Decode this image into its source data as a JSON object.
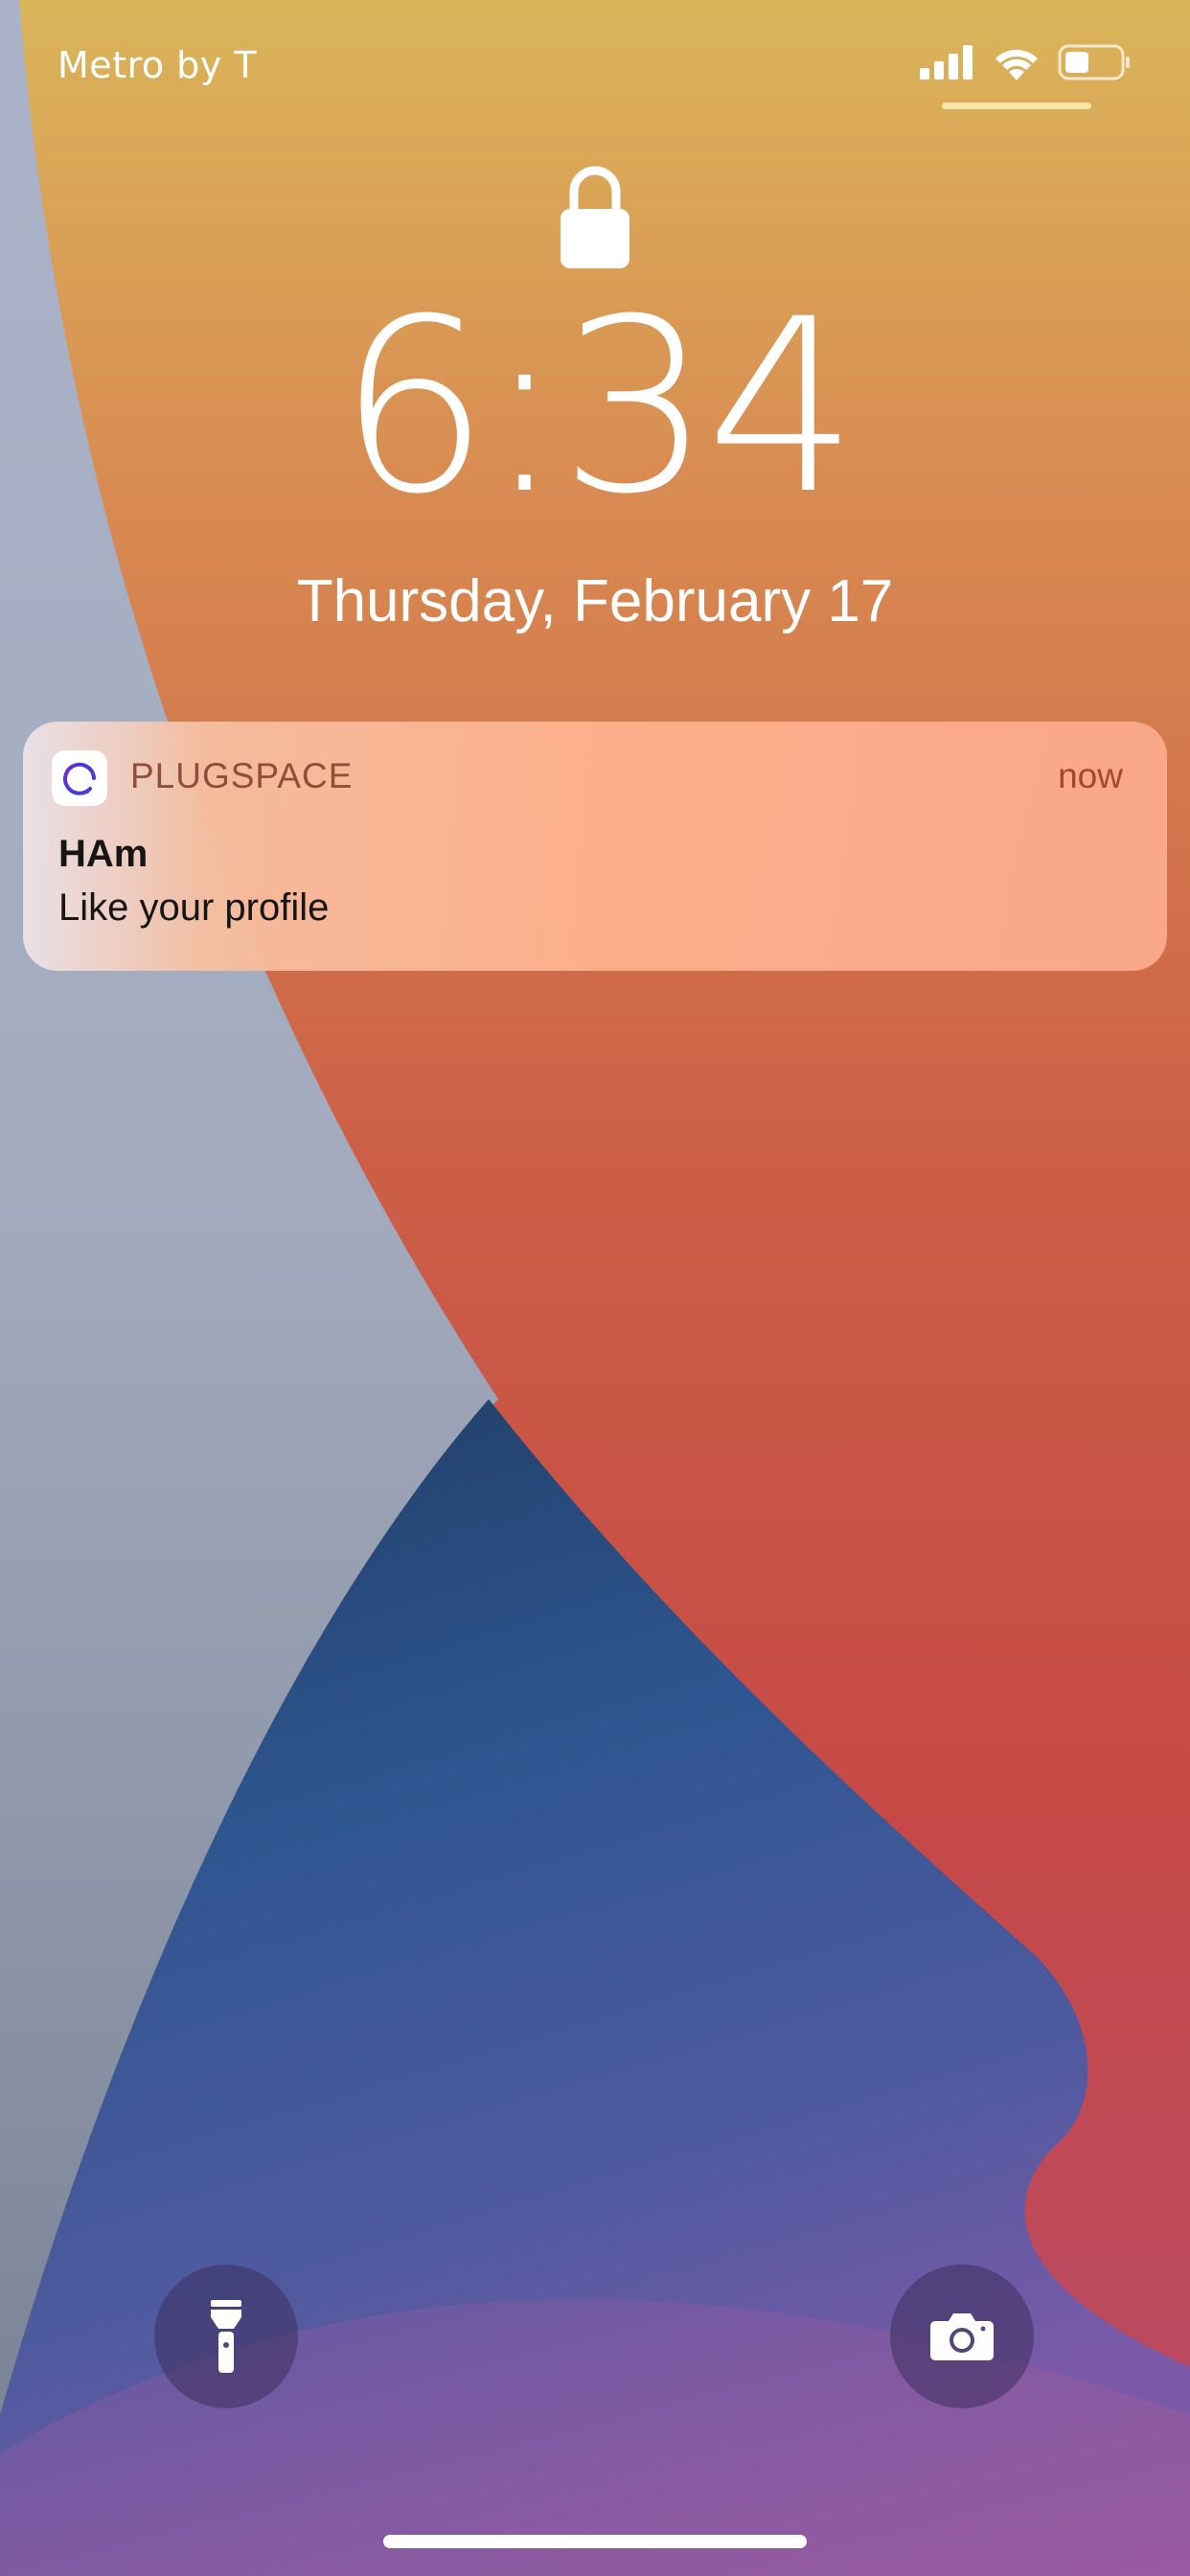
{
  "status_bar": {
    "carrier": "Metro by T",
    "signal_icon": "cellular-signal-icon",
    "wifi_icon": "wifi-icon",
    "battery_icon": "battery-icon",
    "battery_level": 0.4
  },
  "lock_screen": {
    "lock_icon": "lock-icon",
    "time": "6:34",
    "date": "Thursday, February 17"
  },
  "notification": {
    "app_icon": "plugspace-app-icon",
    "app_name": "PLUGSPACE",
    "time": "now",
    "title": "HAm",
    "body": "Like your profile"
  },
  "quick_actions": {
    "flashlight_icon": "flashlight-icon",
    "camera_icon": "camera-icon"
  },
  "colors": {
    "wallpaper_orange": "#d98d52",
    "wallpaper_red": "#c94a45",
    "wallpaper_blue": "#2f4f80",
    "wallpaper_gray": "#a9b0c2",
    "notification_accent": "#a2482c"
  }
}
